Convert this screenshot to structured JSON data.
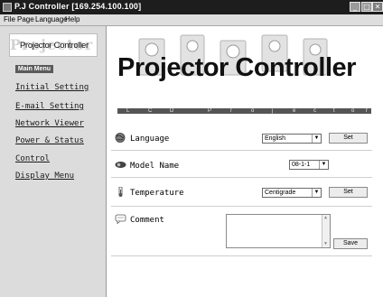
{
  "window": {
    "title": "P.J Controller [169.254.100.100]",
    "min_glyph": "_",
    "max_glyph": "□",
    "close_glyph": "✕"
  },
  "menubar": {
    "items": [
      "File",
      "Page",
      "Language",
      "Help"
    ]
  },
  "sidebar": {
    "logo_text": "Projector Controller",
    "menu_tag": "Main Menu",
    "links": [
      "Initial Setting",
      "E-mail Setting",
      "Network Viewer",
      "Power & Status",
      "Control",
      "Display Menu"
    ]
  },
  "banner": {
    "title": "Projector Controller",
    "strip_letters": [
      "L",
      "C",
      "D",
      "P",
      "r",
      "o",
      "j",
      "e",
      "c",
      "t",
      "o",
      "r"
    ]
  },
  "settings": {
    "language": {
      "label": "Language",
      "icon": "globe-icon",
      "value": "English",
      "button": "Set"
    },
    "model": {
      "label": "Model Name",
      "icon": "projector-icon",
      "value": "08-1-1"
    },
    "temperature": {
      "label": "Temperature",
      "icon": "thermometer-icon",
      "value": "Centigrade",
      "button": "Set"
    },
    "comment": {
      "label": "Comment",
      "icon": "speech-bubble-icon",
      "value": "",
      "button": "Save"
    }
  },
  "colors": {
    "titlebar": "#1d1d1d",
    "sidebar": "#dcdcdc",
    "strip": "#555555"
  }
}
